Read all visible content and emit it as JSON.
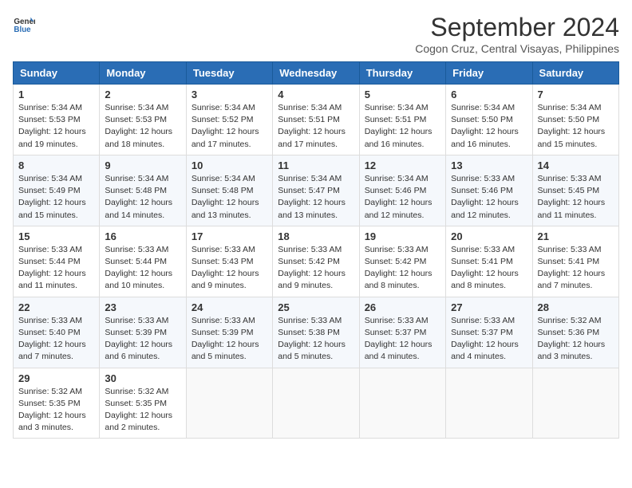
{
  "header": {
    "logo_line1": "General",
    "logo_line2": "Blue",
    "month": "September 2024",
    "location": "Cogon Cruz, Central Visayas, Philippines"
  },
  "weekdays": [
    "Sunday",
    "Monday",
    "Tuesday",
    "Wednesday",
    "Thursday",
    "Friday",
    "Saturday"
  ],
  "weeks": [
    [
      {
        "day": "1",
        "info": "Sunrise: 5:34 AM\nSunset: 5:53 PM\nDaylight: 12 hours\nand 19 minutes."
      },
      {
        "day": "2",
        "info": "Sunrise: 5:34 AM\nSunset: 5:53 PM\nDaylight: 12 hours\nand 18 minutes."
      },
      {
        "day": "3",
        "info": "Sunrise: 5:34 AM\nSunset: 5:52 PM\nDaylight: 12 hours\nand 17 minutes."
      },
      {
        "day": "4",
        "info": "Sunrise: 5:34 AM\nSunset: 5:51 PM\nDaylight: 12 hours\nand 17 minutes."
      },
      {
        "day": "5",
        "info": "Sunrise: 5:34 AM\nSunset: 5:51 PM\nDaylight: 12 hours\nand 16 minutes."
      },
      {
        "day": "6",
        "info": "Sunrise: 5:34 AM\nSunset: 5:50 PM\nDaylight: 12 hours\nand 16 minutes."
      },
      {
        "day": "7",
        "info": "Sunrise: 5:34 AM\nSunset: 5:50 PM\nDaylight: 12 hours\nand 15 minutes."
      }
    ],
    [
      {
        "day": "8",
        "info": "Sunrise: 5:34 AM\nSunset: 5:49 PM\nDaylight: 12 hours\nand 15 minutes."
      },
      {
        "day": "9",
        "info": "Sunrise: 5:34 AM\nSunset: 5:48 PM\nDaylight: 12 hours\nand 14 minutes."
      },
      {
        "day": "10",
        "info": "Sunrise: 5:34 AM\nSunset: 5:48 PM\nDaylight: 12 hours\nand 13 minutes."
      },
      {
        "day": "11",
        "info": "Sunrise: 5:34 AM\nSunset: 5:47 PM\nDaylight: 12 hours\nand 13 minutes."
      },
      {
        "day": "12",
        "info": "Sunrise: 5:34 AM\nSunset: 5:46 PM\nDaylight: 12 hours\nand 12 minutes."
      },
      {
        "day": "13",
        "info": "Sunrise: 5:33 AM\nSunset: 5:46 PM\nDaylight: 12 hours\nand 12 minutes."
      },
      {
        "day": "14",
        "info": "Sunrise: 5:33 AM\nSunset: 5:45 PM\nDaylight: 12 hours\nand 11 minutes."
      }
    ],
    [
      {
        "day": "15",
        "info": "Sunrise: 5:33 AM\nSunset: 5:44 PM\nDaylight: 12 hours\nand 11 minutes."
      },
      {
        "day": "16",
        "info": "Sunrise: 5:33 AM\nSunset: 5:44 PM\nDaylight: 12 hours\nand 10 minutes."
      },
      {
        "day": "17",
        "info": "Sunrise: 5:33 AM\nSunset: 5:43 PM\nDaylight: 12 hours\nand 9 minutes."
      },
      {
        "day": "18",
        "info": "Sunrise: 5:33 AM\nSunset: 5:42 PM\nDaylight: 12 hours\nand 9 minutes."
      },
      {
        "day": "19",
        "info": "Sunrise: 5:33 AM\nSunset: 5:42 PM\nDaylight: 12 hours\nand 8 minutes."
      },
      {
        "day": "20",
        "info": "Sunrise: 5:33 AM\nSunset: 5:41 PM\nDaylight: 12 hours\nand 8 minutes."
      },
      {
        "day": "21",
        "info": "Sunrise: 5:33 AM\nSunset: 5:41 PM\nDaylight: 12 hours\nand 7 minutes."
      }
    ],
    [
      {
        "day": "22",
        "info": "Sunrise: 5:33 AM\nSunset: 5:40 PM\nDaylight: 12 hours\nand 7 minutes."
      },
      {
        "day": "23",
        "info": "Sunrise: 5:33 AM\nSunset: 5:39 PM\nDaylight: 12 hours\nand 6 minutes."
      },
      {
        "day": "24",
        "info": "Sunrise: 5:33 AM\nSunset: 5:39 PM\nDaylight: 12 hours\nand 5 minutes."
      },
      {
        "day": "25",
        "info": "Sunrise: 5:33 AM\nSunset: 5:38 PM\nDaylight: 12 hours\nand 5 minutes."
      },
      {
        "day": "26",
        "info": "Sunrise: 5:33 AM\nSunset: 5:37 PM\nDaylight: 12 hours\nand 4 minutes."
      },
      {
        "day": "27",
        "info": "Sunrise: 5:33 AM\nSunset: 5:37 PM\nDaylight: 12 hours\nand 4 minutes."
      },
      {
        "day": "28",
        "info": "Sunrise: 5:32 AM\nSunset: 5:36 PM\nDaylight: 12 hours\nand 3 minutes."
      }
    ],
    [
      {
        "day": "29",
        "info": "Sunrise: 5:32 AM\nSunset: 5:35 PM\nDaylight: 12 hours\nand 3 minutes."
      },
      {
        "day": "30",
        "info": "Sunrise: 5:32 AM\nSunset: 5:35 PM\nDaylight: 12 hours\nand 2 minutes."
      },
      {
        "day": "",
        "info": ""
      },
      {
        "day": "",
        "info": ""
      },
      {
        "day": "",
        "info": ""
      },
      {
        "day": "",
        "info": ""
      },
      {
        "day": "",
        "info": ""
      }
    ]
  ]
}
